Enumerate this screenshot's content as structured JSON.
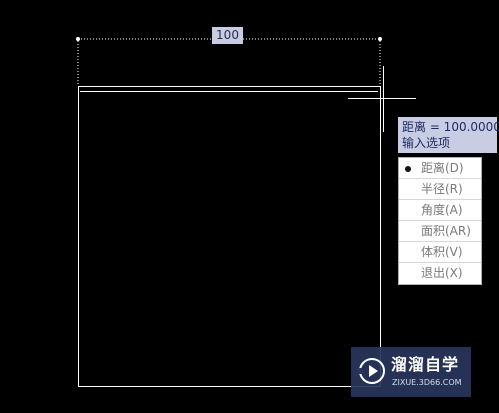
{
  "dimension": {
    "value_label": "100"
  },
  "tooltip": {
    "distance_line": "距离 = 100.0000",
    "prompt_line": "输入选项"
  },
  "menu": {
    "selected_index": 0,
    "items": [
      {
        "label": "距离(D)"
      },
      {
        "label": "半径(R)"
      },
      {
        "label": "角度(A)"
      },
      {
        "label": "面积(AR)"
      },
      {
        "label": "体积(V)"
      },
      {
        "label": "退出(X)"
      }
    ]
  },
  "watermark": {
    "title": "溜溜自学",
    "url": "ZIXUE.3D66.COM",
    "logo_icon": "play-icon"
  },
  "colors": {
    "background": "#000000",
    "drawing_lines": "#ffffff",
    "tooltip_bg": "#c9cde3",
    "tooltip_text": "#1f2a66",
    "watermark_bg": "#28365c"
  }
}
